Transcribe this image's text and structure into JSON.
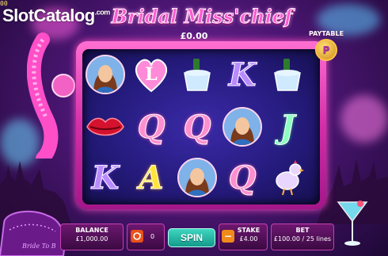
{
  "watermark": {
    "text": "SlotCatalog",
    "suffix": ".com"
  },
  "corner_number": "00",
  "game": {
    "title": "Bridal Miss'chief",
    "win_amount": "£0.00",
    "paytable_label": "PAYTABLE",
    "paytable_icon_letter": "P"
  },
  "reels": {
    "rows": [
      [
        "bride",
        "heart-L",
        "champagne",
        "K",
        "champagne"
      ],
      [
        "lips",
        "Q",
        "Q",
        "bride",
        "J"
      ],
      [
        "K",
        "A",
        "bride",
        "Q",
        "chicken"
      ]
    ]
  },
  "controls": {
    "balance_label": "BALANCE",
    "balance_value": "£1,000.00",
    "autoplay_count": "0",
    "spin_label": "SPIN",
    "stake_label": "STAKE",
    "stake_value": "£4.00",
    "bet_label": "BET",
    "bet_value": "£100.00 / 25 lines"
  },
  "decor": {
    "sofa_text": "Bride To B"
  },
  "colors": {
    "frame_pink": "#d42ea8",
    "reel_bg": "#241a7a",
    "spin_teal": "#139a8a",
    "stake_minus": "#f08a1a",
    "autoplay_orange": "#e8521a"
  }
}
